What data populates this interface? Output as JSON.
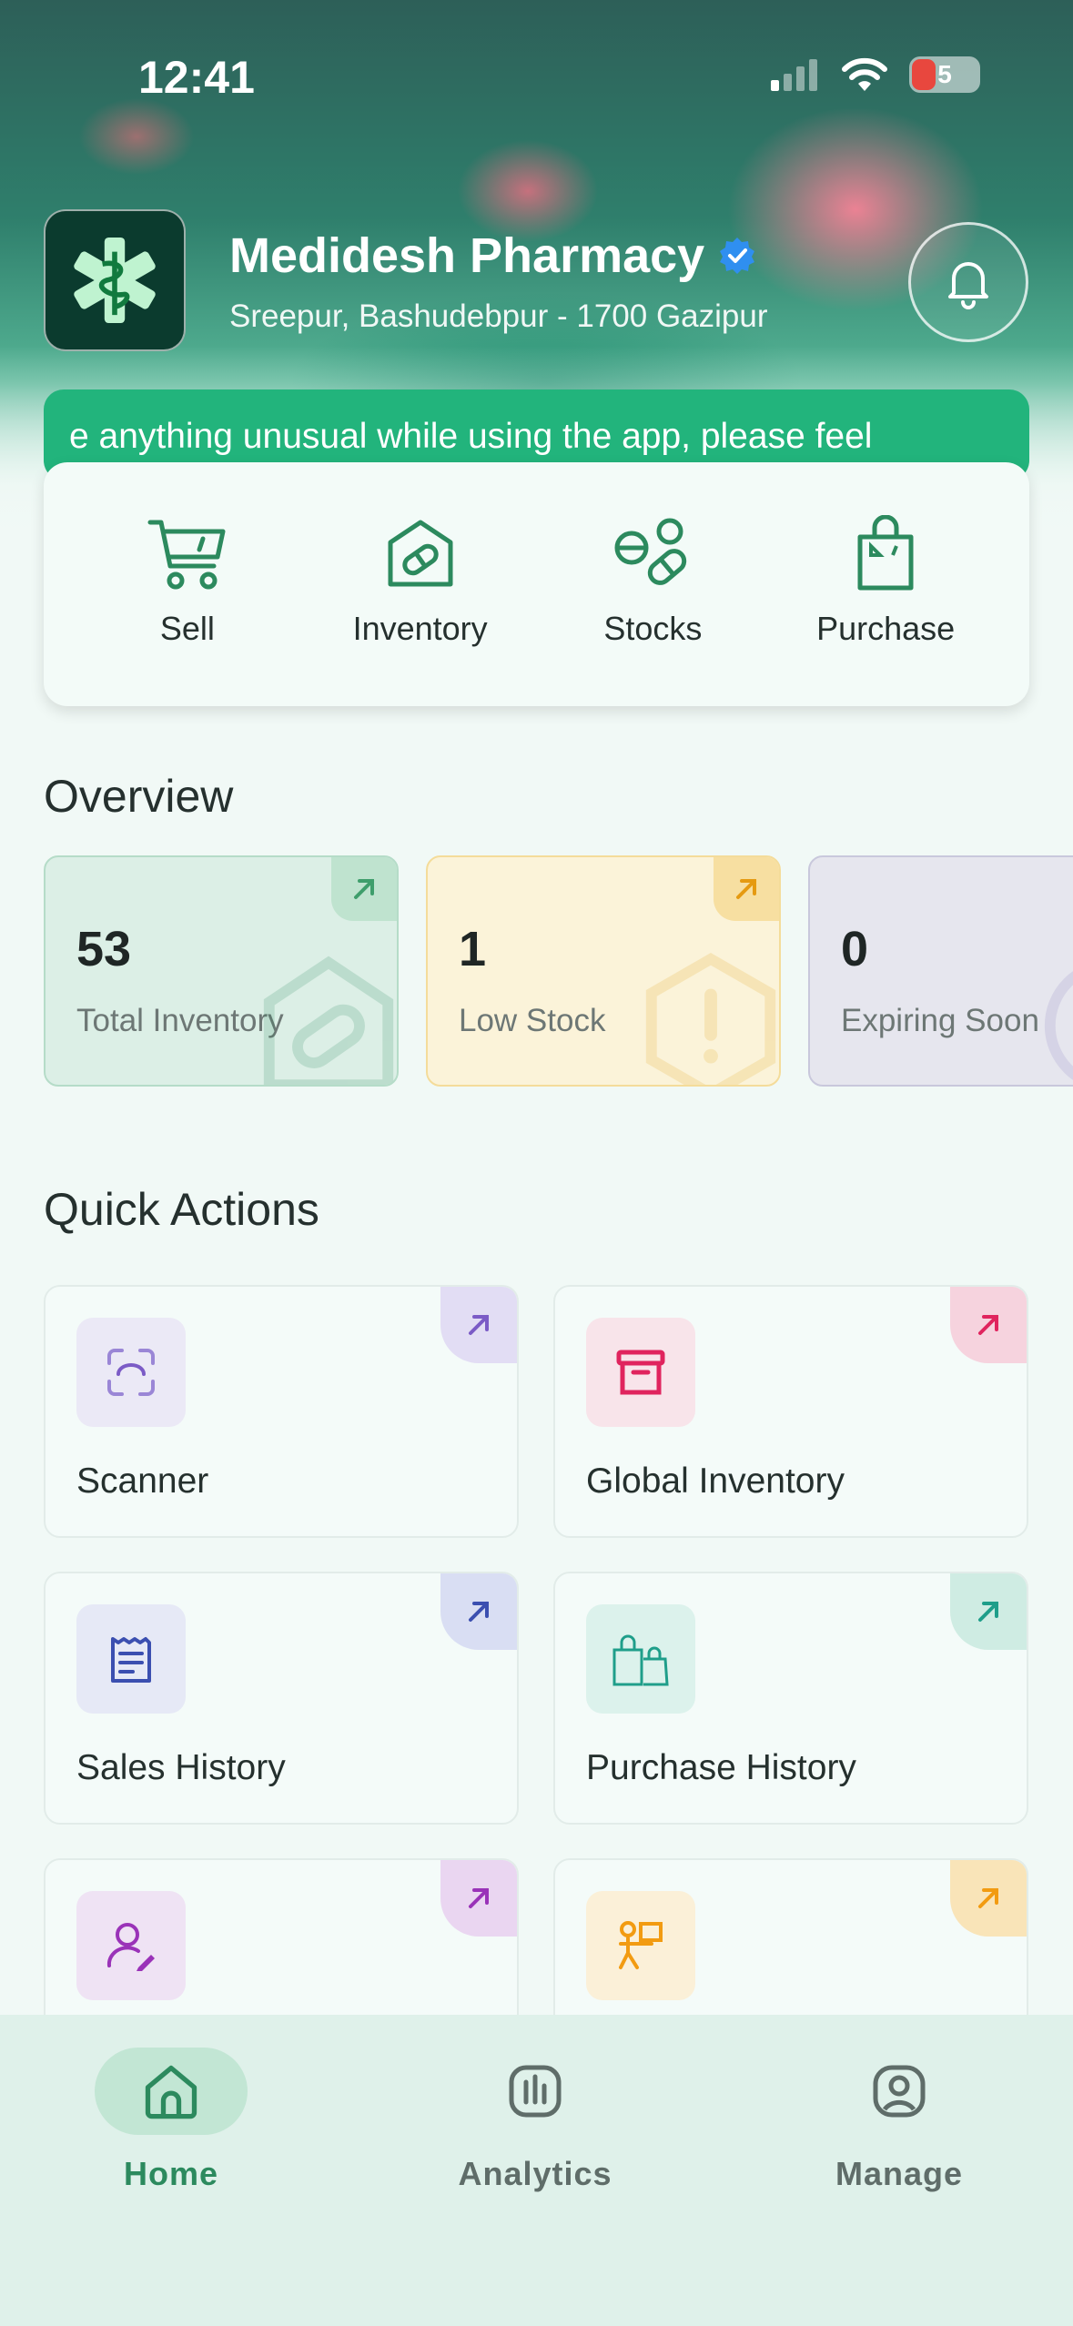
{
  "status_bar": {
    "time": "12:41",
    "battery": "5"
  },
  "header": {
    "shop_name": "Medidesh Pharmacy",
    "address": "Sreepur, Bashudebpur - 1700 Gazipur"
  },
  "marquee_text": "e anything unusual while using the app, please feel",
  "top_actions": [
    {
      "label": "Sell",
      "icon": "cart-icon"
    },
    {
      "label": "Inventory",
      "icon": "pill-box-icon"
    },
    {
      "label": "Stocks",
      "icon": "pills-icon"
    },
    {
      "label": "Purchase",
      "icon": "shopping-bag-icon"
    }
  ],
  "overview": {
    "title": "Overview",
    "cards": [
      {
        "value": "53",
        "label": "Total Inventory",
        "color": "#dcefe6"
      },
      {
        "value": "1",
        "label": "Low Stock",
        "color": "#fbf3d9"
      },
      {
        "value": "0",
        "label": "Expiring Soon",
        "color": "#e6e6ee"
      }
    ]
  },
  "quick_actions": {
    "title": "Quick Actions",
    "items": [
      {
        "label": "Scanner",
        "icon": "scan-icon",
        "accent": "#7b5bc6"
      },
      {
        "label": "Global Inventory",
        "icon": "archive-box-icon",
        "accent": "#e0245e"
      },
      {
        "label": "Sales History",
        "icon": "receipt-icon",
        "accent": "#3b4fb0"
      },
      {
        "label": "Purchase History",
        "icon": "shopping-bags-icon",
        "accent": "#1f9e8a"
      },
      {
        "label": "",
        "icon": "user-edit-icon",
        "accent": "#9a33b8"
      },
      {
        "label": "",
        "icon": "delivery-person-icon",
        "accent": "#f29b11"
      }
    ]
  },
  "bottom_nav": [
    {
      "label": "Home",
      "icon": "home-icon",
      "active": true
    },
    {
      "label": "Analytics",
      "icon": "analytics-icon",
      "active": false
    },
    {
      "label": "Manage",
      "icon": "user-circle-icon",
      "active": false
    }
  ],
  "colors": {
    "brand_green": "#2c8a5e",
    "banner_green": "#22b47c",
    "nav_bg": "#dff1ea"
  }
}
